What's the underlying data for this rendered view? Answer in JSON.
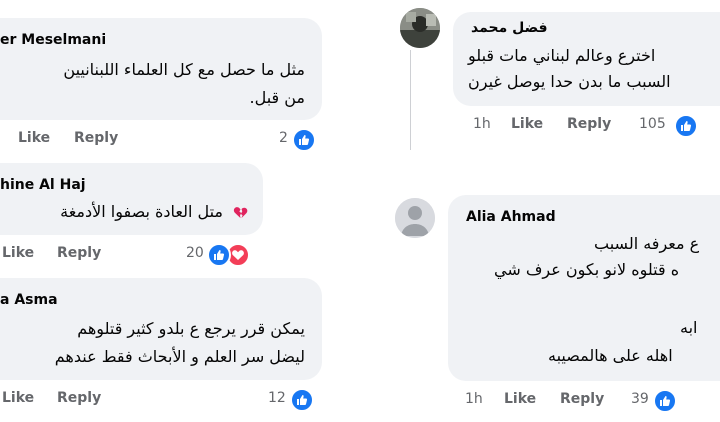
{
  "left_comments": [
    {
      "author": "er Meselmani",
      "lines": [
        "مثل ما حصل مع كل العلماء اللبنانيين",
        "من قبل."
      ],
      "like_label": "Like",
      "reply_label": "Reply",
      "reaction_count": "2",
      "reactions": [
        "like"
      ]
    },
    {
      "author": "hine Al Haj",
      "lines": [
        "متل العادة بصفوا الأدمغة"
      ],
      "like_label": "Like",
      "reply_label": "Reply",
      "reaction_count": "20",
      "reactions": [
        "like",
        "love"
      ]
    },
    {
      "author": "a Asma",
      "lines": [
        "يمكن قرر يرجع ع بلدو كثير قتلوهم",
        "ليضل سر العلم و الأبحاث فقط عندهم"
      ],
      "like_label": "Like",
      "reply_label": "Reply",
      "reaction_count": "12",
      "reactions": [
        "like"
      ]
    }
  ],
  "right_comments": [
    {
      "author": "فضل محمد",
      "lines": [
        "اخترع وعالم لبناني مات قبلو",
        "السبب ما بدن حدا يوصل غيرن"
      ],
      "time": "1h",
      "like_label": "Like",
      "reply_label": "Reply",
      "reaction_count": "105",
      "reactions": [
        "like"
      ]
    },
    {
      "author": "Alia Ahmad",
      "lines": [
        "ع معرفه السبب",
        "ه قتلوه لانو بكون عرف شي",
        "",
        "ابه",
        "اهله على هالمصيبه"
      ],
      "time": "1h",
      "like_label": "Like",
      "reply_label": "Reply",
      "reaction_count": "39",
      "reactions": [
        "like"
      ]
    }
  ],
  "colors": {
    "bubble": "#f0f2f5",
    "action_text": "#65676b",
    "like_blue": "#1877f2",
    "love_red": "#f33e58"
  }
}
